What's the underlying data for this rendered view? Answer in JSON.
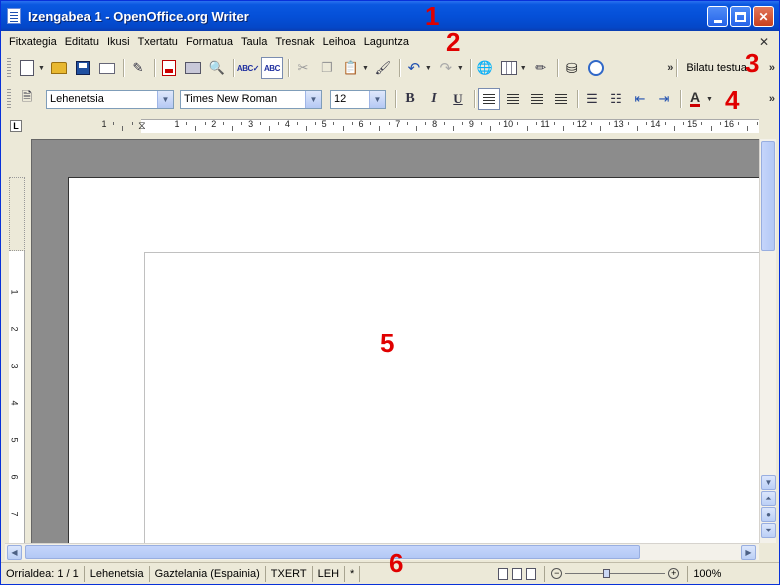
{
  "window": {
    "title": "Izengabea 1 - OpenOffice.org Writer"
  },
  "menubar": {
    "items": [
      "Fitxategia",
      "Editatu",
      "Ikusi",
      "Txertatu",
      "Formatua",
      "Taula",
      "Tresnak",
      "Leihoa",
      "Laguntza"
    ]
  },
  "standard_toolbar": {
    "search_label": "Bilatu testua"
  },
  "format_toolbar": {
    "style": "Lehenetsia",
    "font": "Times New Roman",
    "size": "12",
    "bold_label": "B",
    "italic_label": "I",
    "underline_label": "U",
    "font_color_label": "A"
  },
  "ruler": {
    "numbers": [
      "1",
      "1",
      "2",
      "3",
      "4",
      "5",
      "6",
      "7",
      "8",
      "9",
      "10",
      "11",
      "12",
      "13",
      "14",
      "15",
      "16"
    ]
  },
  "vertical_ruler": {
    "numbers": [
      "1",
      "1",
      "2",
      "3",
      "4",
      "5",
      "6",
      "7"
    ]
  },
  "statusbar": {
    "page": "Orrialdea: 1 / 1",
    "style": "Lehenetsia",
    "language": "Gaztelania (Espainia)",
    "insert_mode": "TXERT",
    "selection_mode": "LEH",
    "modified": "*",
    "zoom": "100%",
    "zoom_level": 100
  },
  "annotations": [
    "1",
    "2",
    "3",
    "4",
    "5",
    "6"
  ],
  "colors": {
    "titlebar": "#0550d8",
    "annotation": "#e00000",
    "doc_background": "#8c8c8c"
  }
}
